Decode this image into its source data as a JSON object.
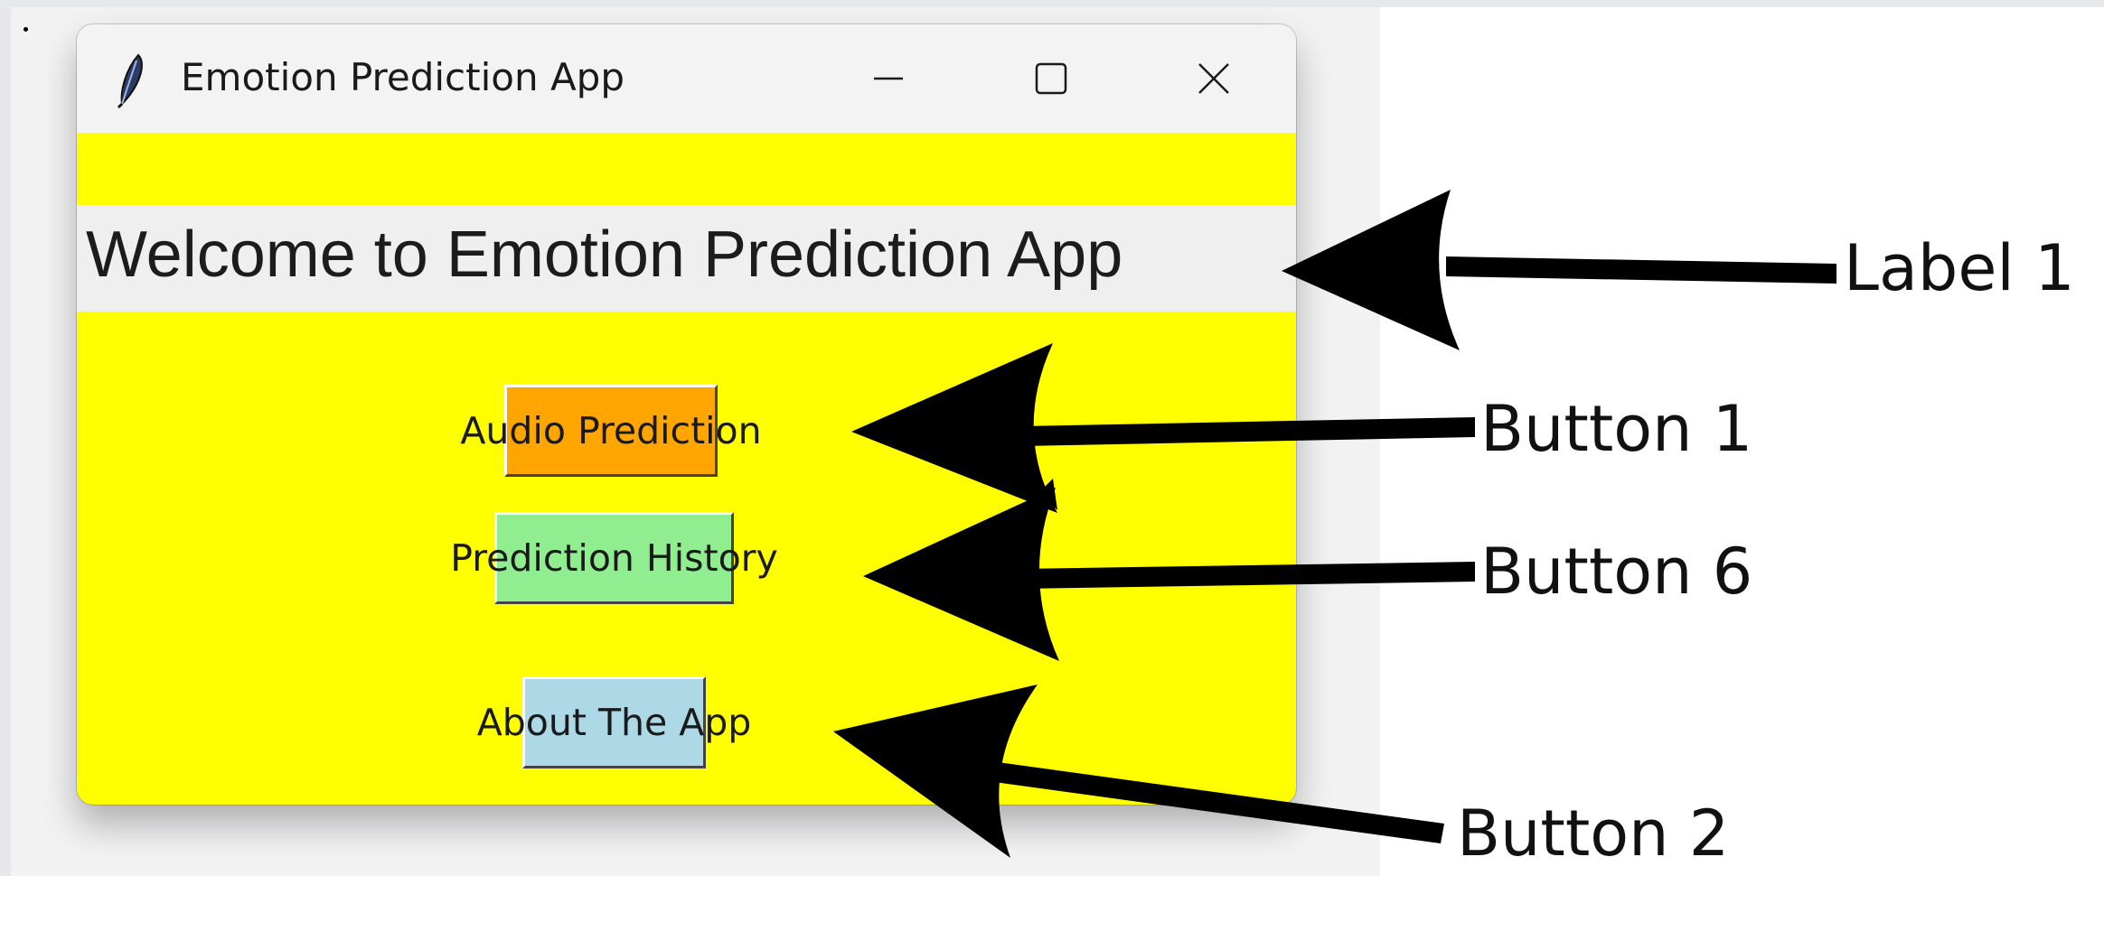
{
  "window": {
    "title": "Emotion Prediction App",
    "controls": {
      "minimize": "minimize-icon",
      "maximize": "maximize-icon",
      "close": "close-icon"
    },
    "icon": "feather-icon",
    "background_color": "#ffff00"
  },
  "main": {
    "welcome_label": "Welcome to Emotion Prediction App",
    "buttons": [
      {
        "label": "Audio Prediction",
        "color": "#ffa500"
      },
      {
        "label": "Prediction History",
        "color": "#90ee90"
      },
      {
        "label": "About The App",
        "color": "#add8e6"
      }
    ]
  },
  "annotations": {
    "label1": "Label 1",
    "button1": "Button 1",
    "button6": "Button 6",
    "button2": "Button 2"
  }
}
